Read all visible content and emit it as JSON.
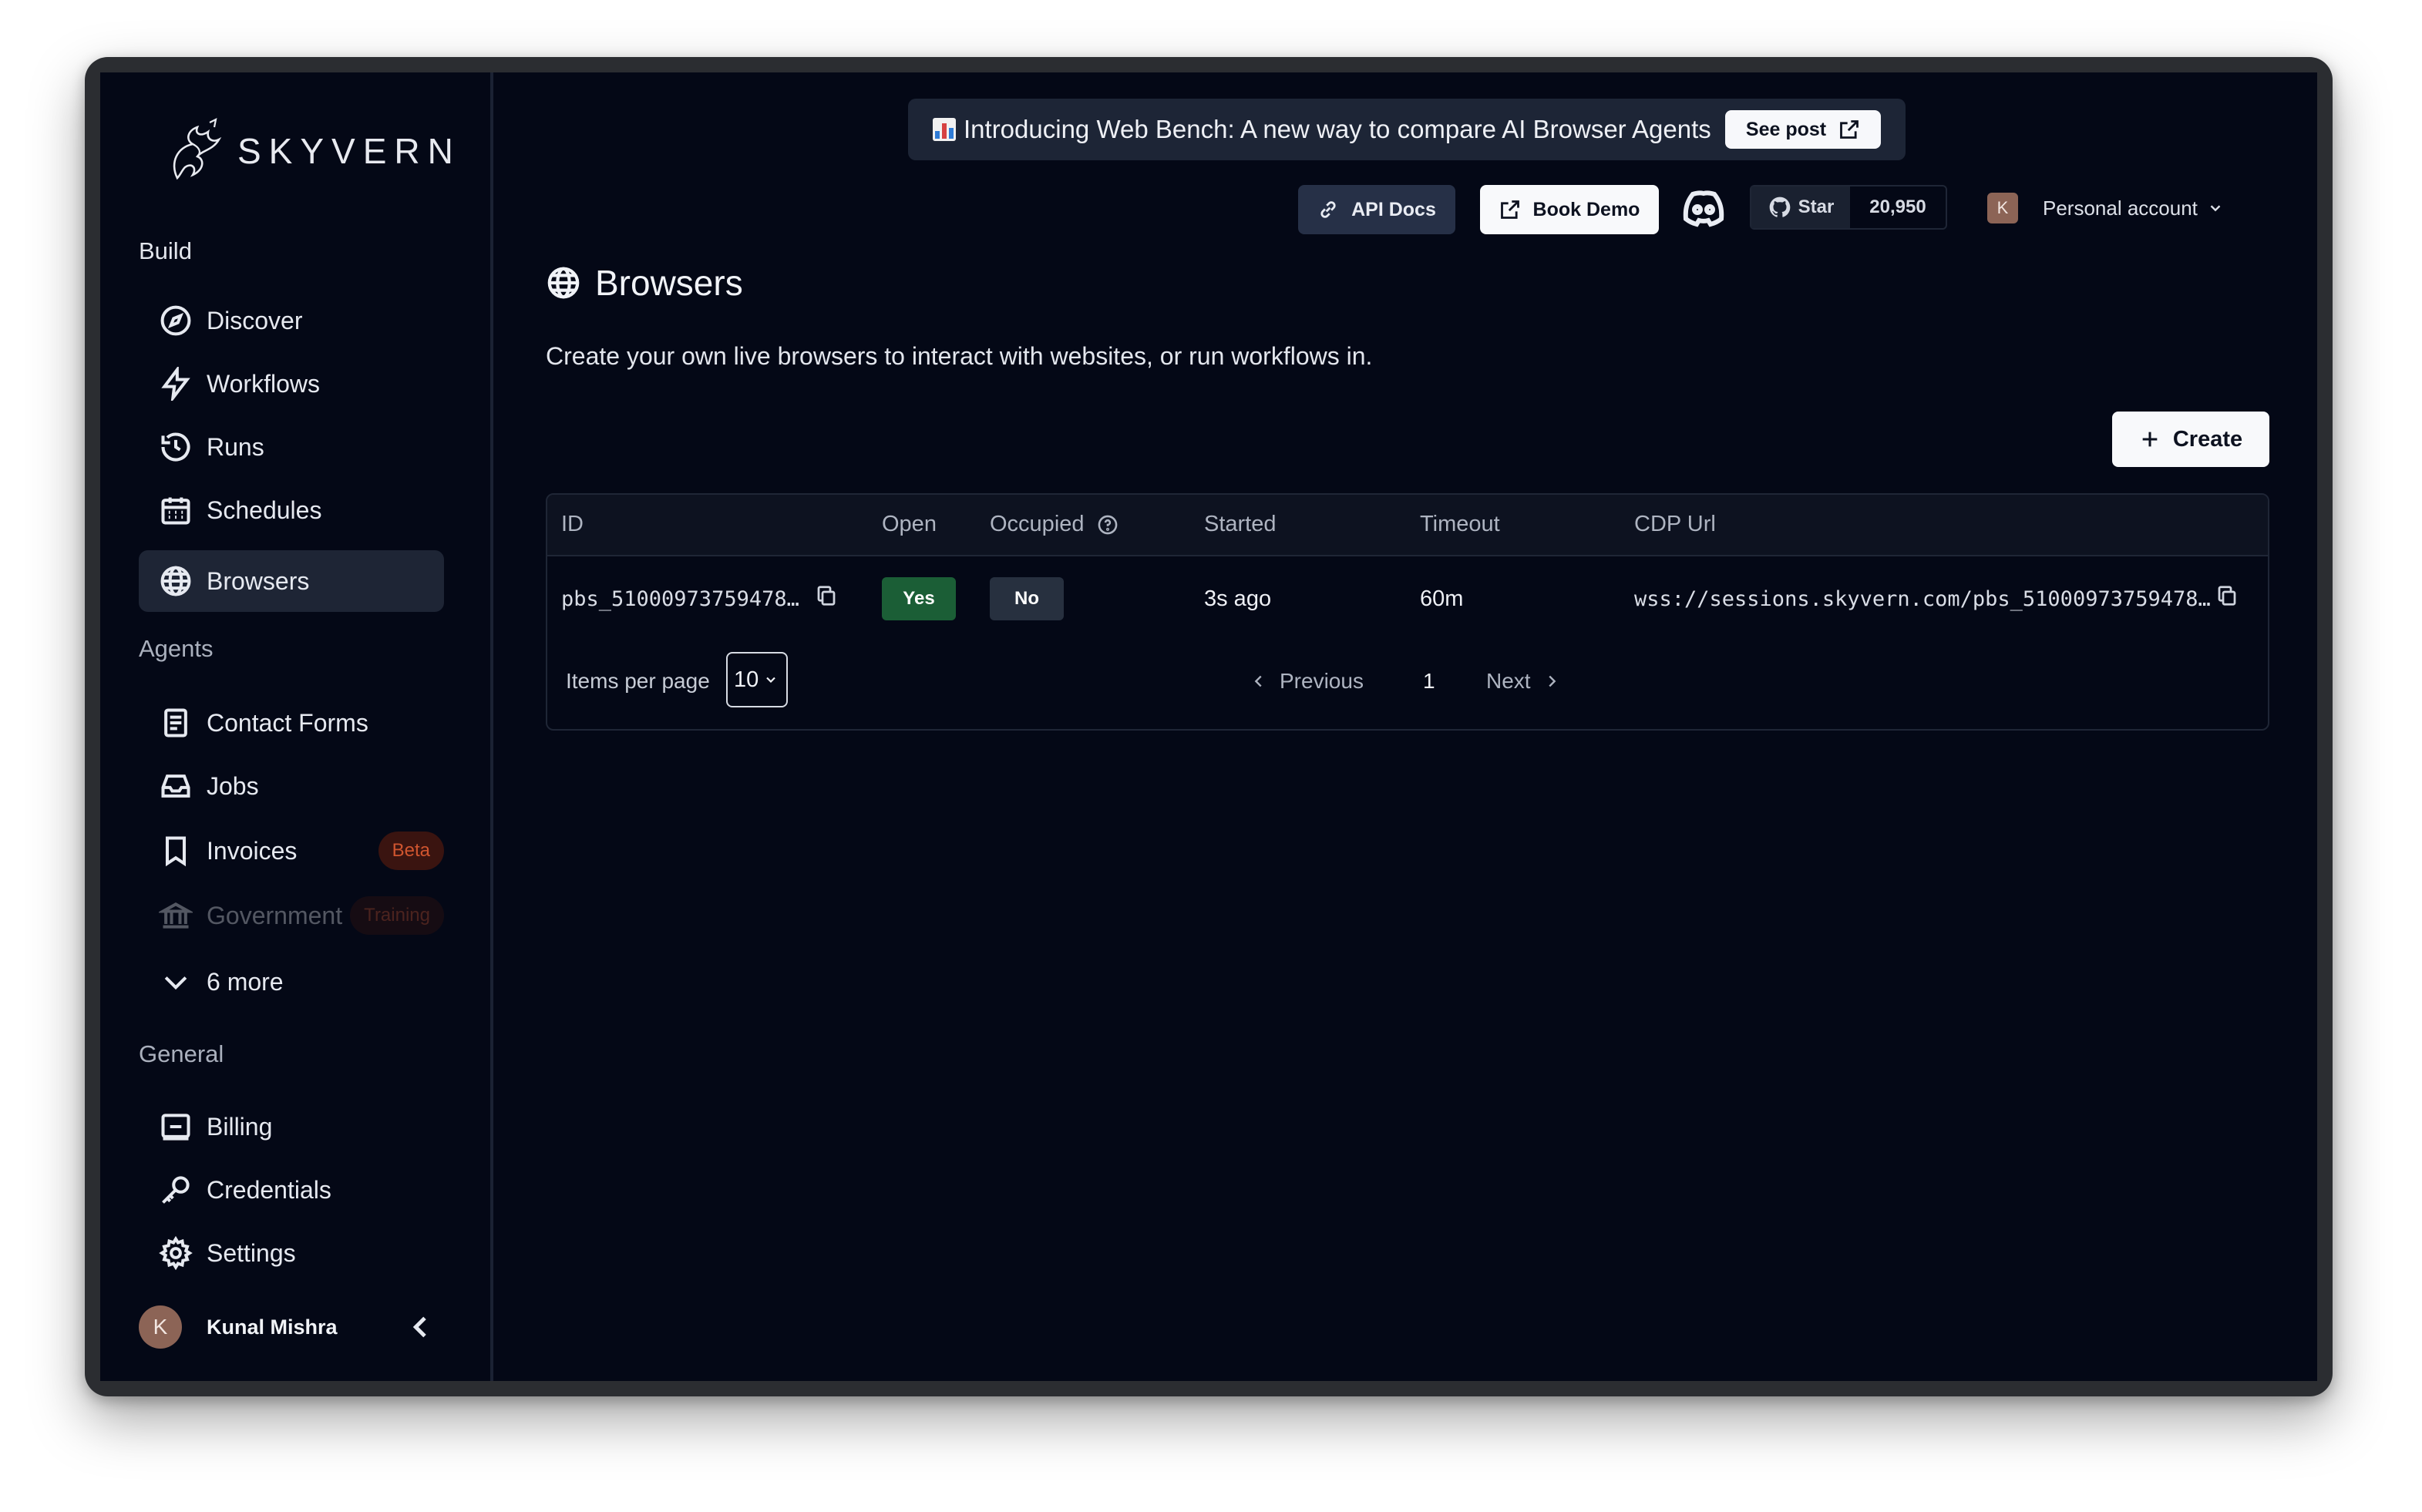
{
  "brand": {
    "name": "SKYVERN"
  },
  "sidebar": {
    "sections": [
      {
        "title": "Build"
      },
      {
        "title": "Agents"
      },
      {
        "title": "General"
      }
    ],
    "build_items": [
      {
        "label": "Discover",
        "icon": "compass-icon"
      },
      {
        "label": "Workflows",
        "icon": "lightning-icon"
      },
      {
        "label": "Runs",
        "icon": "history-icon"
      },
      {
        "label": "Schedules",
        "icon": "calendar-icon"
      },
      {
        "label": "Browsers",
        "icon": "globe-icon",
        "active": true
      }
    ],
    "agent_items": [
      {
        "label": "Contact Forms",
        "icon": "document-icon"
      },
      {
        "label": "Jobs",
        "icon": "inbox-icon"
      },
      {
        "label": "Invoices",
        "icon": "bookmark-icon",
        "badge": "Beta"
      },
      {
        "label": "Government",
        "icon": "building-icon",
        "badge": "Training"
      },
      {
        "label": "6 more",
        "icon": "chevron-down-icon"
      }
    ],
    "general_items": [
      {
        "label": "Billing",
        "icon": "billing-icon"
      },
      {
        "label": "Credentials",
        "icon": "key-icon"
      },
      {
        "label": "Settings",
        "icon": "gear-icon"
      }
    ],
    "user": {
      "initial": "K",
      "name": "Kunal Mishra"
    }
  },
  "banner": {
    "text": "Introducing Web Bench: A new way to compare AI Browser Agents",
    "button": "See post"
  },
  "header": {
    "api_docs": "API Docs",
    "book_demo": "Book Demo",
    "github_star": "Star",
    "github_count": "20,950",
    "account_initial": "K",
    "account_label": "Personal account"
  },
  "page": {
    "title": "Browsers",
    "description": "Create your own live browsers to interact with websites, or run workflows in.",
    "create_button": "Create"
  },
  "table": {
    "columns": [
      "ID",
      "Open",
      "Occupied",
      "Started",
      "Timeout",
      "CDP Url"
    ],
    "rows": [
      {
        "id": "pbs_51000973759478…",
        "open": "Yes",
        "occupied": "No",
        "started": "3s ago",
        "timeout": "60m",
        "cdp_url": "wss://sessions.skyvern.com/pbs_51000973759478…"
      }
    ]
  },
  "pagination": {
    "items_per_page_label": "Items per page",
    "items_per_page_value": "10",
    "previous": "Previous",
    "page": "1",
    "next": "Next"
  },
  "colors": {
    "background": "#040816",
    "open_yes": "#1b5e36",
    "badge_text": "#d0552f"
  }
}
